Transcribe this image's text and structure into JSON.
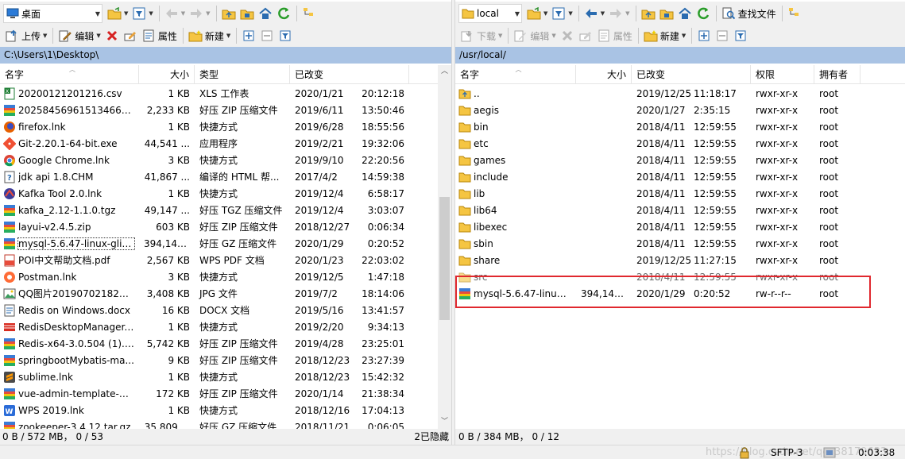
{
  "left": {
    "location": "桌面",
    "toolbar": {
      "upload": "上传",
      "edit": "编辑",
      "properties": "属性",
      "new": "新建"
    },
    "path": "C:\\Users\\1\\Desktop\\",
    "columns": [
      "名字",
      "大小",
      "类型",
      "已改变"
    ],
    "files": [
      {
        "name": "20200121201216.csv",
        "size": "1 KB",
        "type": "XLS 工作表",
        "date": "2020/1/21",
        "time": "20:12:18",
        "icon": "excel-icon"
      },
      {
        "name": "20258456961513466_马...",
        "size": "2,233 KB",
        "type": "好压 ZIP 压缩文件",
        "date": "2019/6/11",
        "time": "13:50:46",
        "icon": "archive-icon"
      },
      {
        "name": "firefox.lnk",
        "size": "1 KB",
        "type": "快捷方式",
        "date": "2019/6/28",
        "time": "18:55:56",
        "icon": "firefox-icon"
      },
      {
        "name": "Git-2.20.1-64-bit.exe",
        "size": "44,541 ...",
        "type": "应用程序",
        "date": "2019/2/21",
        "time": "19:32:06",
        "icon": "git-icon"
      },
      {
        "name": "Google Chrome.lnk",
        "size": "3 KB",
        "type": "快捷方式",
        "date": "2019/9/10",
        "time": "22:20:56",
        "icon": "chrome-icon"
      },
      {
        "name": "jdk api 1.8.CHM",
        "size": "41,867 ...",
        "type": "编译的 HTML 帮...",
        "date": "2017/4/2",
        "time": "14:59:38",
        "icon": "help-icon"
      },
      {
        "name": "Kafka Tool 2.0.lnk",
        "size": "1 KB",
        "type": "快捷方式",
        "date": "2019/12/4",
        "time": "6:58:17",
        "icon": "kafka-icon"
      },
      {
        "name": "kafka_2.12-1.1.0.tgz",
        "size": "49,147 ...",
        "type": "好压 TGZ 压缩文件",
        "date": "2019/12/4",
        "time": "3:03:07",
        "icon": "archive-icon"
      },
      {
        "name": "layui-v2.4.5.zip",
        "size": "603 KB",
        "type": "好压 ZIP 压缩文件",
        "date": "2018/12/27",
        "time": "0:06:34",
        "icon": "archive-icon"
      },
      {
        "name": "mysql-5.6.47-linux-glibc...",
        "size": "394,148...",
        "type": "好压 GZ 压缩文件",
        "date": "2020/1/29",
        "time": "0:20:52",
        "icon": "archive-icon"
      },
      {
        "name": "POI中文帮助文档.pdf",
        "size": "2,567 KB",
        "type": "WPS PDF 文档",
        "date": "2020/1/23",
        "time": "22:03:02",
        "icon": "pdf-icon"
      },
      {
        "name": "Postman.lnk",
        "size": "3 KB",
        "type": "快捷方式",
        "date": "2019/12/5",
        "time": "1:47:18",
        "icon": "postman-icon"
      },
      {
        "name": "QQ图片2019070218244...",
        "size": "3,408 KB",
        "type": "JPG 文件",
        "date": "2019/7/2",
        "time": "18:14:06",
        "icon": "image-icon"
      },
      {
        "name": "Redis on Windows.docx",
        "size": "16 KB",
        "type": "DOCX 文档",
        "date": "2019/5/16",
        "time": "13:41:57",
        "icon": "document-icon"
      },
      {
        "name": "RedisDesktopManager....",
        "size": "1 KB",
        "type": "快捷方式",
        "date": "2019/2/20",
        "time": "9:34:13",
        "icon": "redis-icon"
      },
      {
        "name": "Redis-x64-3.0.504 (1).zip",
        "size": "5,742 KB",
        "type": "好压 ZIP 压缩文件",
        "date": "2019/4/28",
        "time": "23:25:01",
        "icon": "archive-icon"
      },
      {
        "name": "springbootMybatis-ma...",
        "size": "9 KB",
        "type": "好压 ZIP 压缩文件",
        "date": "2018/12/23",
        "time": "23:27:39",
        "icon": "archive-icon"
      },
      {
        "name": "sublime.lnk",
        "size": "1 KB",
        "type": "快捷方式",
        "date": "2018/12/23",
        "time": "15:42:32",
        "icon": "sublime-icon"
      },
      {
        "name": "vue-admin-template-m...",
        "size": "172 KB",
        "type": "好压 ZIP 压缩文件",
        "date": "2020/1/14",
        "time": "21:38:34",
        "icon": "archive-icon"
      },
      {
        "name": "WPS 2019.lnk",
        "size": "1 KB",
        "type": "快捷方式",
        "date": "2018/12/16",
        "time": "17:04:13",
        "icon": "wps-icon"
      },
      {
        "name": "zookeeper-3.4.12.tar.gz",
        "size": "35,809 ...",
        "type": "好压 GZ 压缩文件",
        "date": "2018/11/21",
        "time": "0:06:05",
        "icon": "archive-icon"
      }
    ],
    "status_left": "0 B / 572 MB，  0 / 53",
    "status_right": "2已隐藏"
  },
  "right": {
    "location": "local",
    "toolbar": {
      "download": "下载",
      "edit": "编辑",
      "properties": "属性",
      "new": "新建",
      "find": "查找文件"
    },
    "path": "/usr/local/",
    "columns": [
      "名字",
      "大小",
      "已改变",
      "权限",
      "拥有者"
    ],
    "files": [
      {
        "name": "..",
        "size": "",
        "date": "2019/12/25",
        "time": "11:18:17",
        "perm": "rwxr-xr-x",
        "owner": "root",
        "icon": "parent-folder-icon"
      },
      {
        "name": "aegis",
        "size": "",
        "date": "2020/1/27",
        "time": "2:35:15",
        "perm": "rwxr-xr-x",
        "owner": "root",
        "icon": "folder-icon"
      },
      {
        "name": "bin",
        "size": "",
        "date": "2018/4/11",
        "time": "12:59:55",
        "perm": "rwxr-xr-x",
        "owner": "root",
        "icon": "folder-icon"
      },
      {
        "name": "etc",
        "size": "",
        "date": "2018/4/11",
        "time": "12:59:55",
        "perm": "rwxr-xr-x",
        "owner": "root",
        "icon": "folder-icon"
      },
      {
        "name": "games",
        "size": "",
        "date": "2018/4/11",
        "time": "12:59:55",
        "perm": "rwxr-xr-x",
        "owner": "root",
        "icon": "folder-icon"
      },
      {
        "name": "include",
        "size": "",
        "date": "2018/4/11",
        "time": "12:59:55",
        "perm": "rwxr-xr-x",
        "owner": "root",
        "icon": "folder-icon"
      },
      {
        "name": "lib",
        "size": "",
        "date": "2018/4/11",
        "time": "12:59:55",
        "perm": "rwxr-xr-x",
        "owner": "root",
        "icon": "folder-icon"
      },
      {
        "name": "lib64",
        "size": "",
        "date": "2018/4/11",
        "time": "12:59:55",
        "perm": "rwxr-xr-x",
        "owner": "root",
        "icon": "folder-icon"
      },
      {
        "name": "libexec",
        "size": "",
        "date": "2018/4/11",
        "time": "12:59:55",
        "perm": "rwxr-xr-x",
        "owner": "root",
        "icon": "folder-icon"
      },
      {
        "name": "sbin",
        "size": "",
        "date": "2018/4/11",
        "time": "12:59:55",
        "perm": "rwxr-xr-x",
        "owner": "root",
        "icon": "folder-icon"
      },
      {
        "name": "share",
        "size": "",
        "date": "2019/12/25",
        "time": "11:27:15",
        "perm": "rwxr-xr-x",
        "owner": "root",
        "icon": "folder-icon"
      },
      {
        "name": "src",
        "size": "",
        "date": "2018/4/11",
        "time": "12:59:55",
        "perm": "rwxr-xr-x",
        "owner": "root",
        "icon": "folder-icon"
      },
      {
        "name": "mysql-5.6.47-linux-...",
        "size": "394,148...",
        "date": "2020/1/29",
        "time": "0:20:52",
        "perm": "rw-r--r--",
        "owner": "root",
        "icon": "archive-icon"
      }
    ],
    "status": "0 B / 384 MB，  0 / 12"
  },
  "bottom": {
    "watermark": "https://blog.csdn.net/qq_38179633",
    "protocol": "SFTP-3",
    "timer": "0:03:38"
  },
  "colors": {
    "pathbar": "#a9c3e4",
    "highlight": "#e0282e",
    "folder": "#f5c542"
  }
}
